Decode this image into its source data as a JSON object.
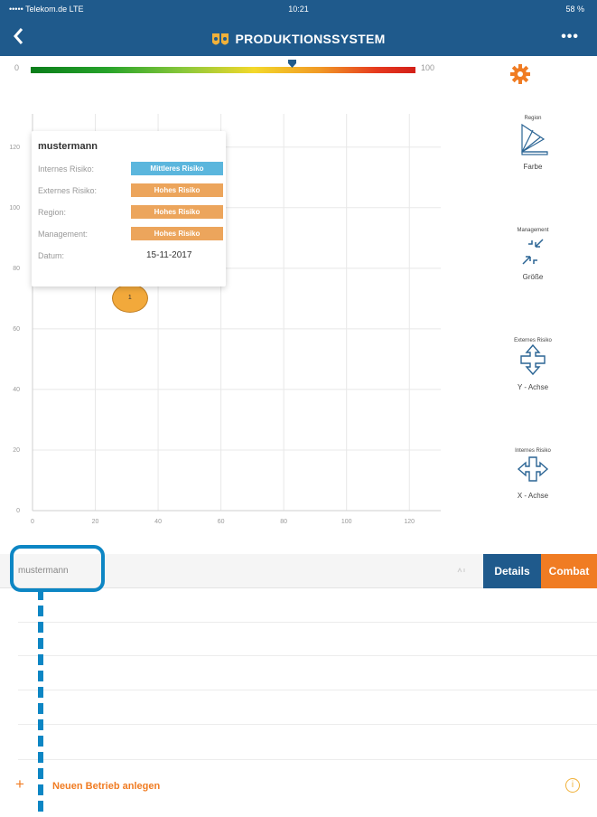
{
  "status": {
    "carrier": "••••• Telekom.de LTE",
    "time": "10:21",
    "battery": "58 %"
  },
  "nav": {
    "back_icon": "chevron-left-icon",
    "title": "PRODUKTIONSSYSTEM",
    "more": "•••"
  },
  "scale": {
    "min_label": "0",
    "max_label": "100",
    "marker_value": 68
  },
  "chart_data": {
    "type": "scatter",
    "x_ticks": [
      "0",
      "20",
      "40",
      "60",
      "80",
      "100",
      "120"
    ],
    "y_ticks": [
      "0",
      "20",
      "40",
      "60",
      "80",
      "100",
      "120"
    ],
    "xlim": [
      0,
      130
    ],
    "ylim": [
      0,
      125
    ],
    "grid": true,
    "points": [
      {
        "x": 31,
        "y": 70,
        "label": "1",
        "color": "#f2a93b"
      }
    ]
  },
  "card": {
    "name": "mustermann",
    "rows": [
      {
        "label": "Internes Risiko:",
        "badge": "Mittleres Risiko",
        "color": "#5bb6dd"
      },
      {
        "label": "Externes Risiko:",
        "badge": "Hohes Risiko",
        "color": "#eca55c"
      },
      {
        "label": "Region:",
        "badge": "Hohes Risiko",
        "color": "#eca55c"
      },
      {
        "label": "Management:",
        "badge": "Hohes Risiko",
        "color": "#eca55c"
      }
    ],
    "date_label": "Datum:",
    "date_value": "15-11-2017"
  },
  "sidebar": {
    "settings_icon": "gear-icon",
    "color": {
      "caption": "Region",
      "label": "Farbe",
      "icon": "color-wheel-icon"
    },
    "size": {
      "caption": "Management",
      "label": "Größe",
      "icon": "resize-icon"
    },
    "y_axis": {
      "caption": "Externes Risiko",
      "label": "Y - Achse",
      "icon": "vertical-arrows-icon"
    },
    "x_axis": {
      "caption": "Internes Risiko",
      "label": "X - Achse",
      "icon": "horizontal-arrows-icon"
    }
  },
  "table": {
    "column_name": "mustermann",
    "sort_icon": "sort-icon",
    "details_label": "Details",
    "combat_label": "Combat"
  },
  "add": {
    "plus": "+",
    "label": "Neuen Betrieb anlegen",
    "info": "i"
  },
  "colors": {
    "navy": "#1f5a8c",
    "orange": "#f07c23",
    "highlight": "#0d86c4"
  }
}
